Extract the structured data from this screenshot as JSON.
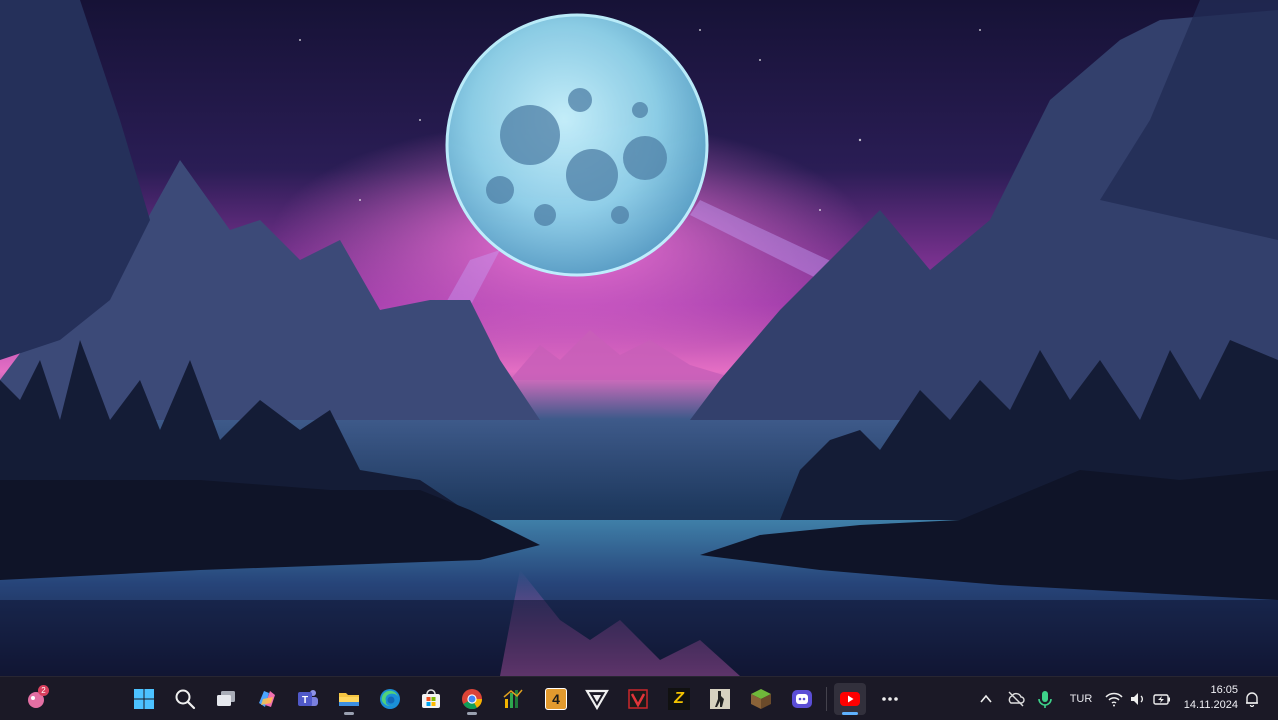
{
  "desktop": {
    "wallpaper": "moonlit-mountain-lake",
    "colors": {
      "sky": "#231a4a",
      "glow": "#e04fc8",
      "moon": "#9fe0f0",
      "water": "#1d2e55"
    }
  },
  "taskbar": {
    "widgets_badge": "2",
    "apps": [
      {
        "name": "start",
        "icon": "windows-start-icon"
      },
      {
        "name": "search",
        "icon": "search-icon"
      },
      {
        "name": "task-view",
        "icon": "task-view-icon"
      },
      {
        "name": "copilot",
        "icon": "copilot-icon"
      },
      {
        "name": "teams",
        "icon": "teams-icon"
      },
      {
        "name": "file-explorer",
        "icon": "folder-icon"
      },
      {
        "name": "edge",
        "icon": "edge-icon"
      },
      {
        "name": "microsoft-store",
        "icon": "store-icon"
      },
      {
        "name": "chrome",
        "icon": "chrome-icon"
      },
      {
        "name": "app-green",
        "icon": "chart-app-icon"
      },
      {
        "name": "app-4",
        "icon": "number-four-app-icon",
        "label": "4"
      },
      {
        "name": "app-triangle",
        "icon": "triangle-app-icon"
      },
      {
        "name": "app-red",
        "icon": "red-app-icon"
      },
      {
        "name": "app-z",
        "icon": "z-app-icon",
        "label": "Z"
      },
      {
        "name": "counter-strike",
        "icon": "counter-strike-icon"
      },
      {
        "name": "minecraft",
        "icon": "minecraft-icon"
      },
      {
        "name": "app-chat",
        "icon": "chat-app-icon"
      },
      {
        "name": "youtube",
        "icon": "youtube-icon"
      },
      {
        "name": "more",
        "icon": "more-icon"
      }
    ],
    "tray": {
      "language": "TUR",
      "time": "16:05",
      "date": "14.11.2024"
    }
  }
}
